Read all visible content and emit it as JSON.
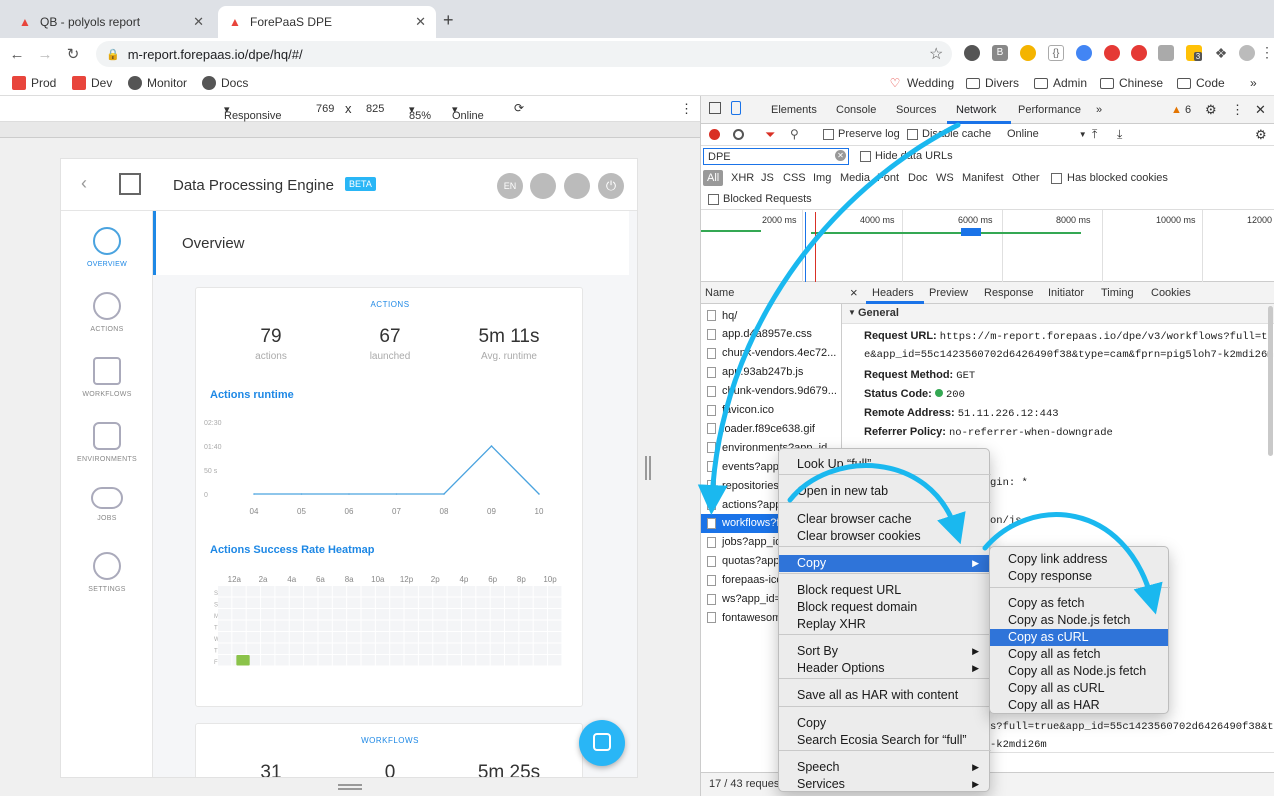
{
  "browser": {
    "tabs": [
      {
        "title": "QB - polyols report"
      },
      {
        "title": "ForePaaS DPE"
      }
    ],
    "url": "m-report.forepaas.io/dpe/hq/#/",
    "bookmarks": [
      "Prod",
      "Dev",
      "Monitor",
      "Docs",
      "Wedding",
      "Divers",
      "Admin",
      "Chinese",
      "Code"
    ],
    "ext_badge": "3"
  },
  "device_toolbar": {
    "mode": "Responsive",
    "width": "769",
    "x": "x",
    "height": "825",
    "zoom": "85%",
    "network": "Online"
  },
  "app": {
    "title": "Data Processing Engine",
    "badge": "BETA",
    "header_buttons": [
      "EN"
    ],
    "sidebar": [
      "OVERVIEW",
      "ACTIONS",
      "WORKFLOWS",
      "ENVIRONMENTS",
      "JOBS",
      "SETTINGS"
    ],
    "page_title": "Overview",
    "actions_card": {
      "heading": "ACTIONS",
      "stats": [
        {
          "value": "79",
          "label": "actions"
        },
        {
          "value": "67",
          "label": "launched"
        },
        {
          "value": "5m 11s",
          "label": "Avg. runtime"
        }
      ],
      "runtime_title": "Actions runtime",
      "runtime_chart": {
        "type": "line",
        "categories": [
          "04",
          "05",
          "06",
          "07",
          "08",
          "09",
          "10"
        ],
        "y_ticks": [
          "02:30",
          "01:40",
          "50 s",
          "0"
        ],
        "ylim_seconds": [
          0,
          150
        ],
        "values_seconds": [
          0,
          0,
          0,
          0,
          0,
          100,
          0
        ]
      },
      "heatmap_title": "Actions Success Rate Heatmap",
      "heatmap": {
        "type": "heatmap",
        "hours": [
          "12a",
          "2a",
          "4a",
          "6a",
          "8a",
          "10a",
          "12p",
          "2p",
          "4p",
          "6p",
          "8p",
          "10p"
        ],
        "days": [
          "S",
          "S",
          "M",
          "T",
          "W",
          "T",
          "F"
        ],
        "filled_cells": [
          {
            "day": 6,
            "hour_col": 1,
            "color": "#8bc34a"
          }
        ]
      }
    },
    "workflows_card": {
      "heading": "WORKFLOWS",
      "stats": [
        {
          "value": "31"
        },
        {
          "value": "0"
        },
        {
          "value": "5m 25s"
        }
      ]
    }
  },
  "devtools": {
    "tabs": [
      "Elements",
      "Console",
      "Sources",
      "Network",
      "Performance"
    ],
    "more": "»",
    "warnings": "6",
    "toolbar": {
      "preserve_log": "Preserve log",
      "disable_cache": "Disable cache",
      "throttle": "Online"
    },
    "filter_value": "DPE",
    "hide_data_urls": "Hide data URLs",
    "types": [
      "All",
      "XHR",
      "JS",
      "CSS",
      "Img",
      "Media",
      "Font",
      "Doc",
      "WS",
      "Manifest",
      "Other"
    ],
    "has_blocked_cookies": "Has blocked cookies",
    "blocked_requests": "Blocked Requests",
    "timeline_ticks": [
      "2000 ms",
      "4000 ms",
      "6000 ms",
      "8000 ms",
      "10000 ms",
      "12000"
    ],
    "list_header": "Name",
    "requests": [
      "hq/",
      "app.d4a8957e.css",
      "chunk-vendors.4ec72...",
      "app.93ab247b.js",
      "chunk-vendors.9d679...",
      "favicon.ico",
      "loader.f89ce638.gif",
      "environments?app_id...",
      "events?app...",
      "repositories?...",
      "actions?app...",
      "workflows?f...",
      "jobs?app_id...",
      "quotas?app...",
      "forepaas-ico...",
      "ws?app_id=...",
      "fontawesom..."
    ],
    "selected_request_index": 11,
    "detail_tabs": [
      "Headers",
      "Preview",
      "Response",
      "Initiator",
      "Timing",
      "Cookies"
    ],
    "close": "×",
    "general_label": "General",
    "general": [
      {
        "key": "Request URL:",
        "value": "https://m-report.forepaas.io/dpe/v3/workflows?full=tru"
      },
      {
        "key": "",
        "value": "e&app_id=55c1423560702d6426490f38&type=cam&fprn=pig5loh7-k2mdi26m"
      },
      {
        "key": "Request Method:",
        "value": "GET"
      },
      {
        "key": "Status Code:",
        "value": "200"
      },
      {
        "key": "Remote Address:",
        "value": "51.11.226.12:443"
      },
      {
        "key": "Referrer Policy:",
        "value": "no-referrer-when-downgrade"
      }
    ],
    "partial_lines": [
      {
        "text": "gin: *",
        "top": 484
      },
      {
        "text": "on/js",
        "top": 522
      },
      {
        "text": "16:39:35 GMT",
        "top": 560
      },
      {
        "text": "s?full=true&app_id=55c1423560702d6426490f38&t",
        "top": 728
      },
      {
        "text": "-k2mdi26m",
        "top": 746
      },
      {
        "text": "on, text/plain, */*",
        "top": 784
      }
    ],
    "status_bar": "17 / 43 reques"
  },
  "context_menu": {
    "items": [
      {
        "label": "Look Up “full”"
      },
      {
        "label": "Open in new tab"
      },
      {
        "label": "Clear browser cache"
      },
      {
        "label": "Clear browser cookies"
      },
      {
        "label": "Copy"
      },
      {
        "label": "Block request URL"
      },
      {
        "label": "Block request domain"
      },
      {
        "label": "Replay XHR"
      },
      {
        "label": "Sort By"
      },
      {
        "label": "Header Options"
      },
      {
        "label": "Save all as HAR with content"
      },
      {
        "label": "Copy"
      },
      {
        "label": "Search Ecosia Search for “full”"
      },
      {
        "label": "Speech"
      },
      {
        "label": "Services"
      }
    ]
  },
  "copy_submenu": {
    "items": [
      {
        "label": "Copy link address"
      },
      {
        "label": "Copy response"
      },
      {
        "label": "Copy as fetch"
      },
      {
        "label": "Copy as Node.js fetch"
      },
      {
        "label": "Copy as cURL"
      },
      {
        "label": "Copy all as fetch"
      },
      {
        "label": "Copy all as Node.js fetch"
      },
      {
        "label": "Copy all as cURL"
      },
      {
        "label": "Copy all as HAR"
      }
    ],
    "highlighted_index": 4
  },
  "colors": {
    "accent": "#1e88e5",
    "arrow": "#1ab8ef",
    "menu_highlight": "#2f74d9",
    "chart_line": "#4aa3df"
  }
}
